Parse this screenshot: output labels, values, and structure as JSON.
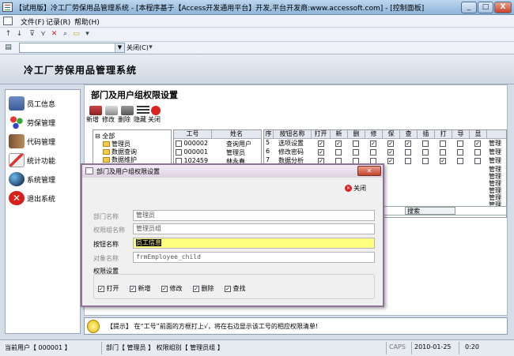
{
  "window": {
    "title": "【试用版】冷工厂劳保用品管理系统 - [本程序基于【Access开发通用平台】开发,平台开发商:www.accessoft.com] - [控制面板]",
    "minimize": "_",
    "maximize": "□",
    "close": "X"
  },
  "menubar": {
    "items": [
      "文件(F)",
      "记录(R)",
      "帮助(H)"
    ]
  },
  "toolbar2": {
    "close_label": "关闭(C)"
  },
  "app": {
    "title": "冷工厂劳保用品管理系统"
  },
  "sidebar": {
    "items": [
      {
        "label": "员工信息",
        "icon": "people-icon"
      },
      {
        "label": "劳保管理",
        "icon": "dots-icon"
      },
      {
        "label": "代码管理",
        "icon": "book-icon"
      },
      {
        "label": "统计功能",
        "icon": "edit-icon"
      },
      {
        "label": "系统管理",
        "icon": "globe-icon"
      },
      {
        "label": "退出系统",
        "icon": "exit-icon"
      }
    ]
  },
  "section": {
    "title": "部门及用户组权限设置",
    "actions": [
      "新增",
      "修改",
      "删除",
      "隐藏",
      "关闭"
    ]
  },
  "tree": {
    "root": "全部",
    "nodes": [
      "管理员",
      "数据查询",
      "数据维护"
    ]
  },
  "users": {
    "headers": [
      "工号",
      "姓名"
    ],
    "rows": [
      {
        "id": "000002",
        "name": "查询用户"
      },
      {
        "id": "000001",
        "name": "管理员"
      },
      {
        "id": "102459",
        "name": "林永春"
      }
    ]
  },
  "perms": {
    "headers": [
      "序",
      "按钮名称",
      "打开",
      "新",
      "删",
      "修",
      "保",
      "查",
      "插",
      "打",
      "导",
      "显"
    ],
    "rows": [
      {
        "no": "5",
        "name": "选项设置",
        "last": "管理"
      },
      {
        "no": "6",
        "name": "修改密码",
        "last": "管理"
      },
      {
        "no": "7",
        "name": "数据分析",
        "last": "管理"
      }
    ],
    "tail": [
      "管理",
      "管理",
      "管理",
      "管理",
      "管理",
      "管理"
    ],
    "search_label": "搜索"
  },
  "dialog": {
    "title": "部门及用户组权限设置",
    "close_label": "关闭",
    "fields": [
      {
        "label": "部门名称",
        "value": "管理员"
      },
      {
        "label": "权限组名称",
        "value": "管理员组"
      },
      {
        "label": "按钮名称",
        "value": "员工信息"
      },
      {
        "label": "对象名称",
        "value": "frmEmployee_child"
      }
    ],
    "perm_group_label": "权限设置",
    "perm_options": [
      {
        "label": "打开",
        "checked": true
      },
      {
        "label": "新增",
        "checked": true
      },
      {
        "label": "修改",
        "checked": true
      },
      {
        "label": "删除",
        "checked": true
      },
      {
        "label": "查找",
        "checked": true
      }
    ]
  },
  "tip": {
    "text": "【提示】 在“工号”前面的方框打上√，将在右边显示该工号的相应权限清单!"
  },
  "status": {
    "user": "当前用户【 000001 】",
    "dept": "部门【 管理员 】 权限组别【 管理员组 】",
    "caps": "CAPS",
    "date": "2010-01-25",
    "time": "0:20"
  },
  "colors": {
    "accent": "#8fb4d9",
    "dialog_border": "#8e7395",
    "highlight": "#ffff80"
  }
}
